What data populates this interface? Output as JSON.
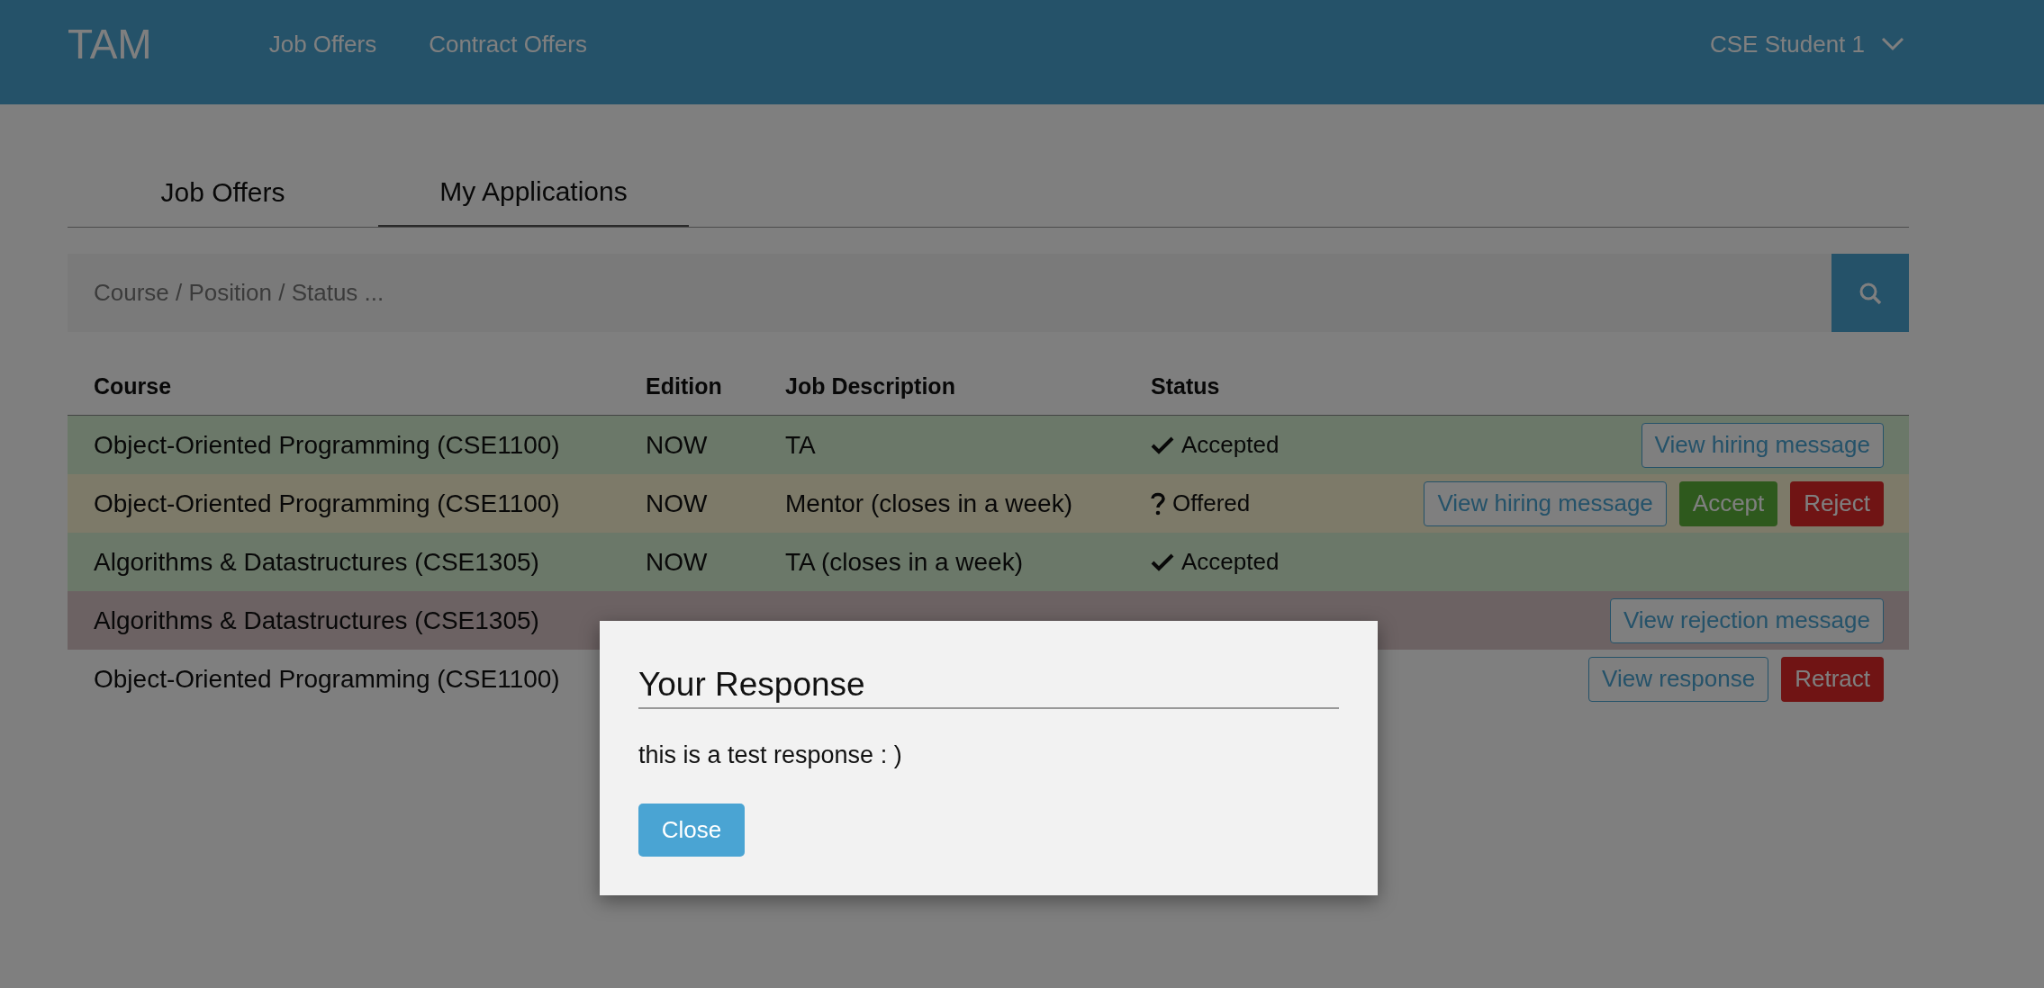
{
  "header": {
    "logo": "TAM",
    "nav": [
      {
        "label": "Job Offers"
      },
      {
        "label": "Contract Offers"
      }
    ],
    "user": "CSE Student 1"
  },
  "tabs": [
    {
      "label": "Job Offers",
      "selected": false
    },
    {
      "label": "My Applications",
      "selected": true
    }
  ],
  "search": {
    "placeholder": "Course / Position / Status ..."
  },
  "table": {
    "columns": [
      "Course",
      "Edition",
      "Job Description",
      "Status"
    ],
    "rows": [
      {
        "course": "Object-Oriented Programming (CSE1100)",
        "edition": "NOW",
        "job": "TA",
        "status": {
          "kind": "accepted",
          "label": "Accepted"
        },
        "actions": [
          {
            "label": "View hiring message",
            "kind": "outline"
          }
        ]
      },
      {
        "course": "Object-Oriented Programming (CSE1100)",
        "edition": "NOW",
        "job": "Mentor (closes in a week)",
        "status": {
          "kind": "offered",
          "label": "Offered"
        },
        "actions": [
          {
            "label": "View hiring message",
            "kind": "outline"
          },
          {
            "label": "Accept",
            "kind": "success"
          },
          {
            "label": "Reject",
            "kind": "danger"
          }
        ]
      },
      {
        "course": "Algorithms & Datastructures (CSE1305)",
        "edition": "NOW",
        "job": "TA (closes in a week)",
        "status": {
          "kind": "accepted",
          "label": "Accepted"
        },
        "actions": []
      },
      {
        "course": "Algorithms & Datastructures (CSE1305)",
        "status": {
          "kind": "rejected"
        },
        "actions": [
          {
            "label": "View rejection message",
            "kind": "outline"
          }
        ]
      },
      {
        "course": "Object-Oriented Programming (CSE1100)",
        "actions": [
          {
            "label": "View response",
            "kind": "outline"
          },
          {
            "label": "Retract",
            "kind": "danger"
          }
        ]
      }
    ]
  },
  "modal": {
    "title": "Your Response",
    "body": "this is a test response : )",
    "button": "Close"
  }
}
